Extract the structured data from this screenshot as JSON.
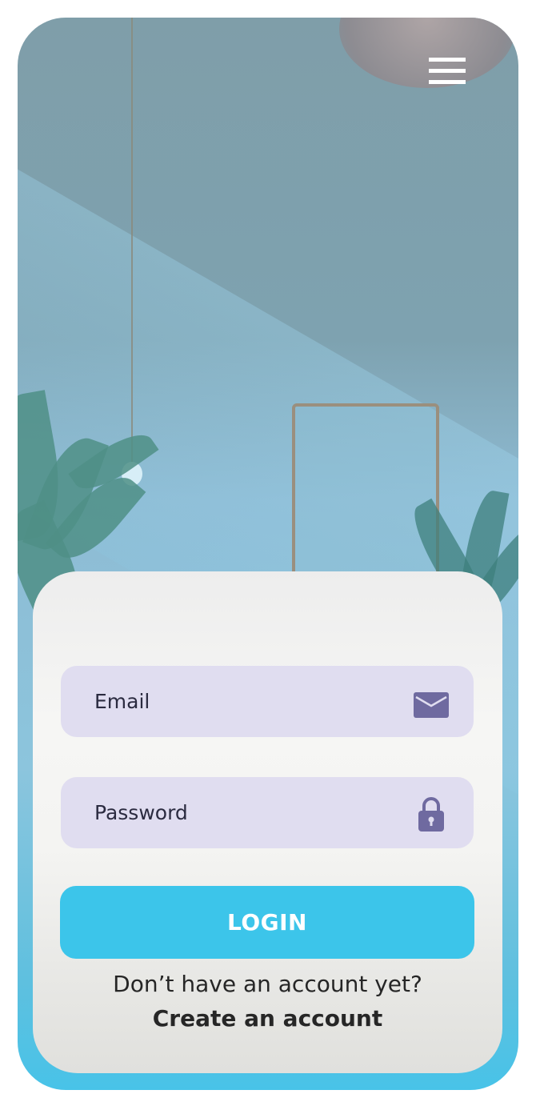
{
  "menu": {
    "icon": "hamburger-menu-icon"
  },
  "login_form": {
    "email": {
      "placeholder": "Email",
      "value": "",
      "icon": "envelope-icon"
    },
    "password": {
      "placeholder": "Password",
      "value": "",
      "icon": "lock-icon"
    },
    "login_label": "LOGIN",
    "signup_prompt": "Don’t have an account yet?",
    "signup_link": "Create an account"
  },
  "colors": {
    "accent": "#3cc5ea",
    "field_background": "#e0ddf0",
    "icon": "#6f6aa0",
    "text": "#262626"
  }
}
